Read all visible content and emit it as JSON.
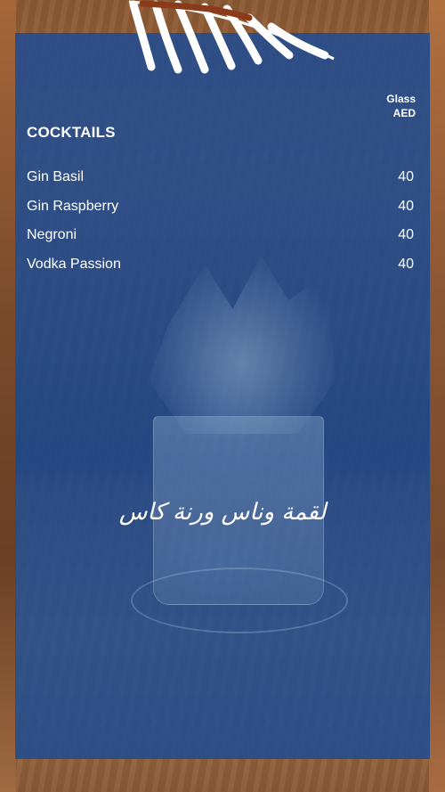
{
  "menu": {
    "section_title": "COCKTAILS",
    "price_header": [
      "Glass",
      "AED"
    ],
    "items": [
      {
        "name": "Gin Basil",
        "price": "40"
      },
      {
        "name": "Gin Raspberry",
        "price": "40"
      },
      {
        "name": "Negroni",
        "price": "40"
      },
      {
        "name": "Vodka Passion",
        "price": "40"
      }
    ],
    "tagline_ar": "لقمة وناس ورنة كاس"
  },
  "colors": {
    "panel_blue": "#1f4c94",
    "text": "#ffffff"
  },
  "icons": [
    "palm-leaf-icon"
  ]
}
